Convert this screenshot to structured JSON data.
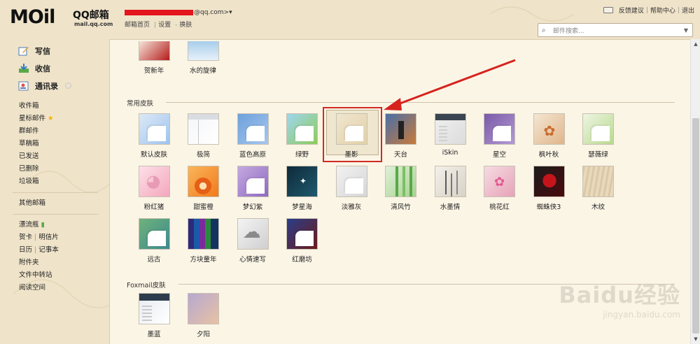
{
  "header": {
    "logo_main": "MOil",
    "logo_qq": "QQ邮箱",
    "logo_domain": "mail.qq.com",
    "account_suffix": "@qq.com>",
    "account_arrow": "▾",
    "links": [
      "邮箱首页",
      "设置",
      "换肤"
    ],
    "top_links": [
      "反馈建议",
      "帮助中心",
      "退出"
    ],
    "search_placeholder": "邮件搜索..."
  },
  "sidebar": {
    "main_actions": [
      {
        "label": "写信",
        "icon": "compose-icon"
      },
      {
        "label": "收信",
        "icon": "inbox-download-icon"
      },
      {
        "label": "通讯录",
        "icon": "contacts-icon"
      }
    ],
    "folders": [
      "收件箱",
      "星标邮件",
      "群邮件",
      "草稿箱",
      "已发送",
      "已删除",
      "垃圾箱"
    ],
    "other": "其他邮箱",
    "apps": {
      "drift_bottle": "漂流瓶",
      "greeting_card": "贺卡",
      "postcard": "明信片",
      "calendar": "日历",
      "notebook": "记事本",
      "attachments": "附件夹",
      "file_transfer": "文件中转站",
      "reading_space": "阅读空间"
    }
  },
  "skins": {
    "top_partial": [
      "贺新年",
      "水的旋律"
    ],
    "common_title": "常用皮肤",
    "common": [
      {
        "label": "默认皮肤",
        "colors": [
          "#dde9f6",
          "#9ec4ee"
        ]
      },
      {
        "label": "极简",
        "colors": [
          "#f5f6f8",
          "#ffffff"
        ]
      },
      {
        "label": "蓝色高原",
        "colors": [
          "#6ea1dc",
          "#a6c7ee"
        ]
      },
      {
        "label": "绿野",
        "colors": [
          "#9fd6ef",
          "#8dcb5a"
        ]
      },
      {
        "label": "墨影",
        "colors": [
          "#f0e6cf",
          "#e2d1a8"
        ],
        "selected": true
      },
      {
        "label": "天台",
        "colors": [
          "#4a6fa8",
          "#c87a3a"
        ]
      },
      {
        "label": "iSkin",
        "colors": [
          "#f0f0f0",
          "#dcdcdc"
        ]
      },
      {
        "label": "星空",
        "colors": [
          "#7a5aa8",
          "#b39ad4"
        ]
      },
      {
        "label": "枫叶秋",
        "colors": [
          "#f4e6d2",
          "#e0b58b"
        ]
      },
      {
        "label": "瑟薇绿",
        "colors": [
          "#eef5e2",
          "#b9d98e"
        ]
      },
      {
        "label": "粉红猪",
        "colors": [
          "#fde0e8",
          "#f4a6bd"
        ]
      },
      {
        "label": "甜蜜橙",
        "colors": [
          "#fbb55a",
          "#f07a1c"
        ]
      },
      {
        "label": "梦幻紫",
        "colors": [
          "#c5a8e0",
          "#8e6bc0"
        ]
      },
      {
        "label": "梦星海",
        "colors": [
          "#0e2a3a",
          "#1f5a6e"
        ]
      },
      {
        "label": "淡雅灰",
        "colors": [
          "#f2f2f2",
          "#d6d6d6"
        ]
      },
      {
        "label": "清风竹",
        "colors": [
          "#dff0d6",
          "#a8d392"
        ]
      },
      {
        "label": "水墨情",
        "colors": [
          "#f3f0ea",
          "#d8d2c6"
        ]
      },
      {
        "label": "桃花红",
        "colors": [
          "#f6dbe3",
          "#e6a3b8"
        ]
      },
      {
        "label": "蜘蛛侠3",
        "colors": [
          "#1b1b1b",
          "#4a0b0e"
        ]
      },
      {
        "label": "木纹",
        "colors": [
          "#dcc8a6",
          "#e8d9bd"
        ]
      },
      {
        "label": "远古",
        "colors": [
          "#6fb27a",
          "#3c8a8f"
        ]
      },
      {
        "label": "方块童年",
        "colors": [
          "#1a2a5a",
          "#3a1a6a"
        ]
      },
      {
        "label": "心情速写",
        "colors": [
          "#f4f4f4",
          "#cfcfcf"
        ]
      },
      {
        "label": "红磨坊",
        "colors": [
          "#2a3e8a",
          "#6a1a1a"
        ]
      }
    ],
    "foxmail_title": "Foxmail皮肤",
    "foxmail": [
      {
        "label": "墨蓝",
        "colors": [
          "#e6ebf1",
          "#ffffff"
        ]
      },
      {
        "label": "夕阳",
        "colors": [
          "#b6a8d0",
          "#e8c2a4"
        ]
      }
    ]
  },
  "watermark": {
    "brand": "Baidu经验",
    "url": "jingyan.baidu.com"
  }
}
